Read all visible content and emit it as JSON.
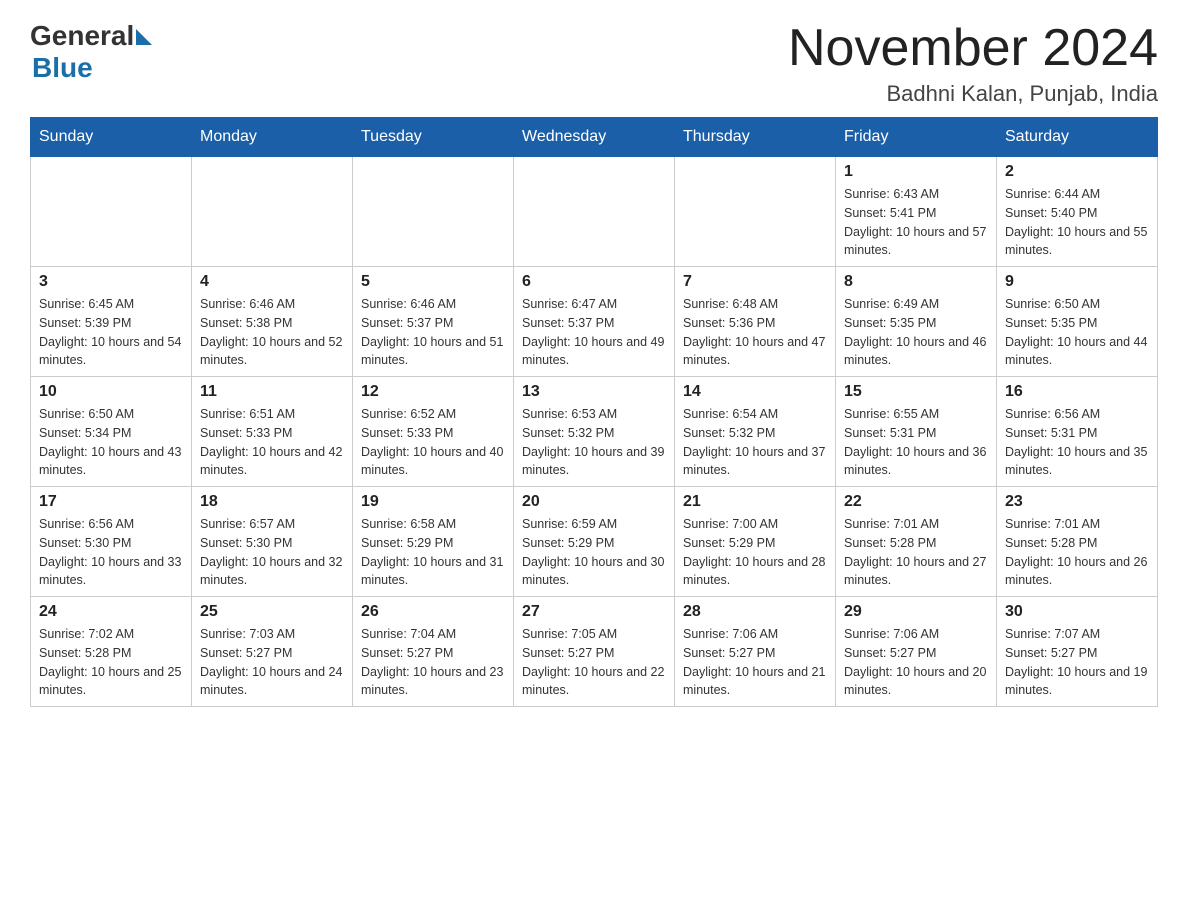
{
  "header": {
    "logo_general": "General",
    "logo_blue": "Blue",
    "month_title": "November 2024",
    "location": "Badhni Kalan, Punjab, India"
  },
  "weekdays": [
    "Sunday",
    "Monday",
    "Tuesday",
    "Wednesday",
    "Thursday",
    "Friday",
    "Saturday"
  ],
  "weeks": [
    [
      {
        "day": "",
        "info": ""
      },
      {
        "day": "",
        "info": ""
      },
      {
        "day": "",
        "info": ""
      },
      {
        "day": "",
        "info": ""
      },
      {
        "day": "",
        "info": ""
      },
      {
        "day": "1",
        "info": "Sunrise: 6:43 AM\nSunset: 5:41 PM\nDaylight: 10 hours and 57 minutes."
      },
      {
        "day": "2",
        "info": "Sunrise: 6:44 AM\nSunset: 5:40 PM\nDaylight: 10 hours and 55 minutes."
      }
    ],
    [
      {
        "day": "3",
        "info": "Sunrise: 6:45 AM\nSunset: 5:39 PM\nDaylight: 10 hours and 54 minutes."
      },
      {
        "day": "4",
        "info": "Sunrise: 6:46 AM\nSunset: 5:38 PM\nDaylight: 10 hours and 52 minutes."
      },
      {
        "day": "5",
        "info": "Sunrise: 6:46 AM\nSunset: 5:37 PM\nDaylight: 10 hours and 51 minutes."
      },
      {
        "day": "6",
        "info": "Sunrise: 6:47 AM\nSunset: 5:37 PM\nDaylight: 10 hours and 49 minutes."
      },
      {
        "day": "7",
        "info": "Sunrise: 6:48 AM\nSunset: 5:36 PM\nDaylight: 10 hours and 47 minutes."
      },
      {
        "day": "8",
        "info": "Sunrise: 6:49 AM\nSunset: 5:35 PM\nDaylight: 10 hours and 46 minutes."
      },
      {
        "day": "9",
        "info": "Sunrise: 6:50 AM\nSunset: 5:35 PM\nDaylight: 10 hours and 44 minutes."
      }
    ],
    [
      {
        "day": "10",
        "info": "Sunrise: 6:50 AM\nSunset: 5:34 PM\nDaylight: 10 hours and 43 minutes."
      },
      {
        "day": "11",
        "info": "Sunrise: 6:51 AM\nSunset: 5:33 PM\nDaylight: 10 hours and 42 minutes."
      },
      {
        "day": "12",
        "info": "Sunrise: 6:52 AM\nSunset: 5:33 PM\nDaylight: 10 hours and 40 minutes."
      },
      {
        "day": "13",
        "info": "Sunrise: 6:53 AM\nSunset: 5:32 PM\nDaylight: 10 hours and 39 minutes."
      },
      {
        "day": "14",
        "info": "Sunrise: 6:54 AM\nSunset: 5:32 PM\nDaylight: 10 hours and 37 minutes."
      },
      {
        "day": "15",
        "info": "Sunrise: 6:55 AM\nSunset: 5:31 PM\nDaylight: 10 hours and 36 minutes."
      },
      {
        "day": "16",
        "info": "Sunrise: 6:56 AM\nSunset: 5:31 PM\nDaylight: 10 hours and 35 minutes."
      }
    ],
    [
      {
        "day": "17",
        "info": "Sunrise: 6:56 AM\nSunset: 5:30 PM\nDaylight: 10 hours and 33 minutes."
      },
      {
        "day": "18",
        "info": "Sunrise: 6:57 AM\nSunset: 5:30 PM\nDaylight: 10 hours and 32 minutes."
      },
      {
        "day": "19",
        "info": "Sunrise: 6:58 AM\nSunset: 5:29 PM\nDaylight: 10 hours and 31 minutes."
      },
      {
        "day": "20",
        "info": "Sunrise: 6:59 AM\nSunset: 5:29 PM\nDaylight: 10 hours and 30 minutes."
      },
      {
        "day": "21",
        "info": "Sunrise: 7:00 AM\nSunset: 5:29 PM\nDaylight: 10 hours and 28 minutes."
      },
      {
        "day": "22",
        "info": "Sunrise: 7:01 AM\nSunset: 5:28 PM\nDaylight: 10 hours and 27 minutes."
      },
      {
        "day": "23",
        "info": "Sunrise: 7:01 AM\nSunset: 5:28 PM\nDaylight: 10 hours and 26 minutes."
      }
    ],
    [
      {
        "day": "24",
        "info": "Sunrise: 7:02 AM\nSunset: 5:28 PM\nDaylight: 10 hours and 25 minutes."
      },
      {
        "day": "25",
        "info": "Sunrise: 7:03 AM\nSunset: 5:27 PM\nDaylight: 10 hours and 24 minutes."
      },
      {
        "day": "26",
        "info": "Sunrise: 7:04 AM\nSunset: 5:27 PM\nDaylight: 10 hours and 23 minutes."
      },
      {
        "day": "27",
        "info": "Sunrise: 7:05 AM\nSunset: 5:27 PM\nDaylight: 10 hours and 22 minutes."
      },
      {
        "day": "28",
        "info": "Sunrise: 7:06 AM\nSunset: 5:27 PM\nDaylight: 10 hours and 21 minutes."
      },
      {
        "day": "29",
        "info": "Sunrise: 7:06 AM\nSunset: 5:27 PM\nDaylight: 10 hours and 20 minutes."
      },
      {
        "day": "30",
        "info": "Sunrise: 7:07 AM\nSunset: 5:27 PM\nDaylight: 10 hours and 19 minutes."
      }
    ]
  ]
}
